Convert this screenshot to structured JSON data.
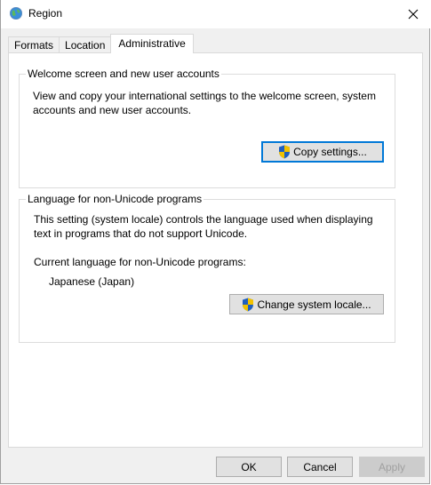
{
  "window": {
    "title": "Region"
  },
  "tabs": [
    {
      "label": "Formats",
      "active": false
    },
    {
      "label": "Location",
      "active": false
    },
    {
      "label": "Administrative",
      "active": true
    }
  ],
  "welcome_group": {
    "title": "Welcome screen and new user accounts",
    "description_line1": "View and copy your international settings to the welcome screen, system",
    "description_line2": "accounts and new user accounts.",
    "copy_button_label": "Copy settings..."
  },
  "locale_group": {
    "title": "Language for non-Unicode programs",
    "description_line1": "This setting (system locale) controls the language used when displaying",
    "description_line2": "text in programs that do not support Unicode.",
    "current_label": "Current language for non-Unicode programs:",
    "current_value": "Japanese (Japan)",
    "change_button_label": "Change system locale..."
  },
  "footer": {
    "ok_label": "OK",
    "cancel_label": "Cancel",
    "apply_label": "Apply"
  },
  "colors": {
    "accent": "#0078d7",
    "shield_blue": "#1f5fbf",
    "shield_yellow": "#f2c200"
  }
}
